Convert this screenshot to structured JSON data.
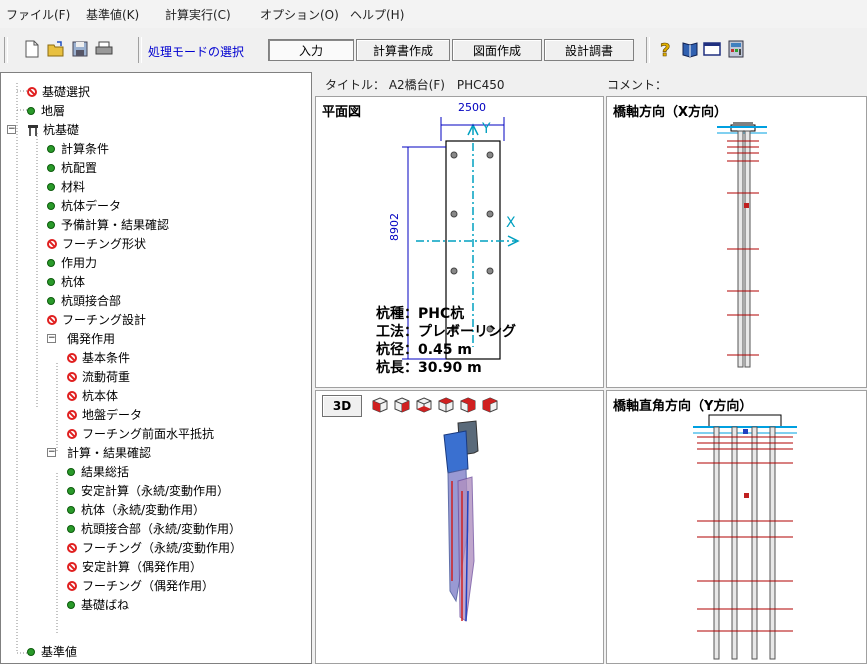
{
  "menu": {
    "file": "ファイル(F)",
    "base": "基準値(K)",
    "calc": "計算実行(C)",
    "option": "オプション(O)",
    "help": "ヘルプ(H)"
  },
  "toolbar": {
    "mode_label": "処理モードの選択",
    "modes": [
      "入力",
      "計算書作成",
      "図面作成",
      "設計調書"
    ]
  },
  "tree": {
    "items": [
      "基礎選択",
      "地層",
      "杭基礎",
      "計算条件",
      "杭配置",
      "材料",
      "杭体データ",
      "予備計算・結果確認",
      "フーチング形状",
      "作用力",
      "杭体",
      "杭頭接合部",
      "フーチング設計",
      "偶発作用",
      "基本条件",
      "流動荷重",
      "杭本体",
      "地盤データ",
      "フーチング前面水平抵抗",
      "計算・結果確認",
      "結果総括",
      "安定計算（永続/変動作用）",
      "杭体（永続/変動作用）",
      "杭頭接合部（永続/変動作用）",
      "フーチング（永続/変動作用）",
      "安定計算（偶発作用）",
      "フーチング（偶発作用）",
      "基礎ばね",
      "基準値"
    ]
  },
  "header": {
    "title": "タイトル： A2橋台(F)　PHC450",
    "comment": "コメント："
  },
  "plan": {
    "title": "平面図",
    "dim_width": "2500",
    "dim_height": "8902",
    "axis_y": "Y",
    "axis_x": "X",
    "pile_type": "杭種：PHC杭",
    "method": "工法：プレボーリング",
    "diameter": "杭径：0.45 m",
    "length": "杭長：30.90 m"
  },
  "view3d": {
    "button": "3D"
  },
  "xdir": {
    "title": "橋軸方向（X方向）"
  },
  "ydir": {
    "title": "橋軸直角方向（Y方向）"
  },
  "colors": {
    "accent_blue": "#0000d0",
    "ok_green": "#2a9a2a",
    "ng_red": "#e02020",
    "dim_cyan": "#00a0c0"
  }
}
